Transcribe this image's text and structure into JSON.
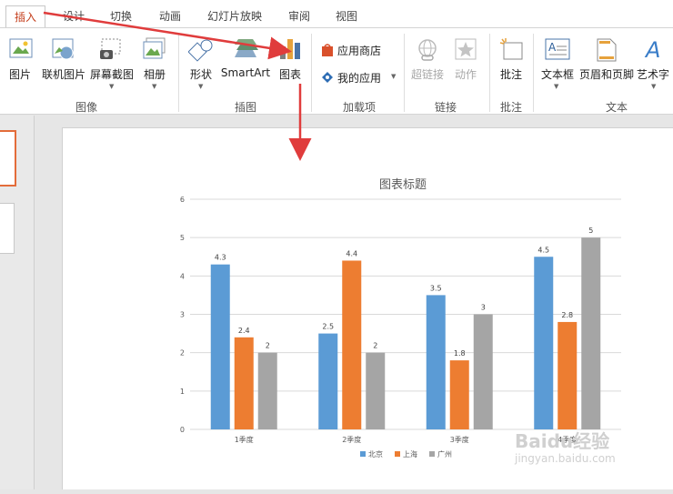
{
  "tabs": [
    {
      "label": "插入",
      "active": true
    },
    {
      "label": "设计"
    },
    {
      "label": "切换"
    },
    {
      "label": "动画"
    },
    {
      "label": "幻灯片放映"
    },
    {
      "label": "审阅"
    },
    {
      "label": "视图"
    }
  ],
  "ribbon": {
    "images": {
      "picture": "图片",
      "online_picture": "联机图片",
      "screenshot": "屏幕截图",
      "album": "相册",
      "group": "图像"
    },
    "illustrations": {
      "shapes": "形状",
      "smartart": "SmartArt",
      "chart": "图表",
      "group": "插图"
    },
    "addins": {
      "store": "应用商店",
      "my_apps": "我的应用",
      "group": "加载项"
    },
    "links": {
      "hyperlink": "超链接",
      "action": "动作",
      "group": "链接"
    },
    "comments": {
      "comment": "批注",
      "group": "批注"
    },
    "text": {
      "textbox": "文本框",
      "header_footer": "页眉和页脚",
      "wordart": "艺术字",
      "group": "文本"
    }
  },
  "chart_data": {
    "type": "bar",
    "title": "图表标题",
    "categories": [
      "1季度",
      "2季度",
      "3季度",
      "4季度"
    ],
    "series": [
      {
        "name": "北京",
        "values": [
          4.3,
          2.5,
          3.5,
          4.5
        ],
        "color": "#5b9bd5"
      },
      {
        "name": "上海",
        "values": [
          2.4,
          4.4,
          1.8,
          2.8
        ],
        "color": "#ed7d31"
      },
      {
        "name": "广州",
        "values": [
          2,
          2,
          3,
          5
        ],
        "color": "#a5a5a5"
      }
    ],
    "ylim": [
      0,
      6
    ],
    "yticks": [
      0,
      1,
      2,
      3,
      4,
      5,
      6
    ],
    "grid": true,
    "legend": "bottom"
  },
  "watermark": {
    "brand": "Baidu经验",
    "url": "jingyan.baidu.com"
  }
}
